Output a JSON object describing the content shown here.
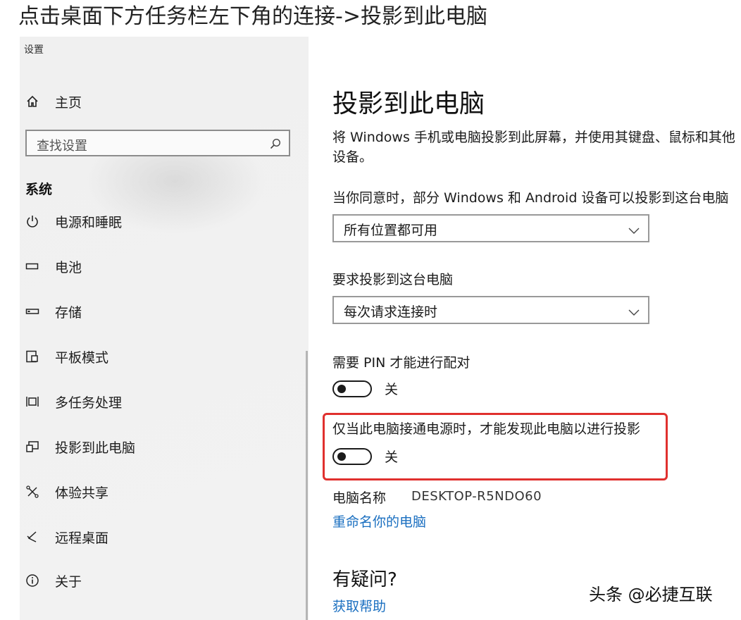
{
  "caption": "点击桌面下方任务栏左下角的连接->投影到此电脑",
  "window": {
    "title": "设置"
  },
  "sidebar": {
    "home_label": "主页",
    "search": {
      "placeholder": "查找设置"
    },
    "section_label": "系统",
    "items": [
      {
        "icon": "power-icon",
        "label": "电源和睡眠"
      },
      {
        "icon": "battery-icon",
        "label": "电池"
      },
      {
        "icon": "storage-icon",
        "label": "存储"
      },
      {
        "icon": "tablet-mode-icon",
        "label": "平板模式"
      },
      {
        "icon": "multitasking-icon",
        "label": "多任务处理"
      },
      {
        "icon": "project-icon",
        "label": "投影到此电脑"
      },
      {
        "icon": "shared-experience-icon",
        "label": "体验共享"
      },
      {
        "icon": "remote-desktop-icon",
        "label": "远程桌面"
      },
      {
        "icon": "info-icon",
        "label": "关于"
      }
    ]
  },
  "main": {
    "title": "投影到此电脑",
    "description_line1": "将 Windows 手机或电脑投影到此屏幕，并使用其键盘、鼠标和其他",
    "description_line2": "设备。",
    "availability": {
      "label": "当你同意时，部分 Windows 和 Android 设备可以投影到这台电脑",
      "value": "所有位置都可用"
    },
    "ask_to_project": {
      "label": "要求投影到这台电脑",
      "value": "每次请求连接时"
    },
    "require_pin": {
      "label": "需要 PIN 才能进行配对",
      "state": "关"
    },
    "plugged_in_only": {
      "label": "仅当此电脑接通电源时，才能发现此电脑以进行投影",
      "state": "关"
    },
    "pc_name": {
      "label": "电脑名称",
      "value": "DESKTOP-R5NDO60"
    },
    "rename_link": "重命名你的电脑",
    "questions_heading": "有疑问?",
    "help_link": "获取帮助"
  },
  "watermark": "头条 @必捷互联",
  "colors": {
    "highlight": "#e0302e",
    "link": "#1a6fc0",
    "sidebar_bg": "#f0f0f0"
  }
}
